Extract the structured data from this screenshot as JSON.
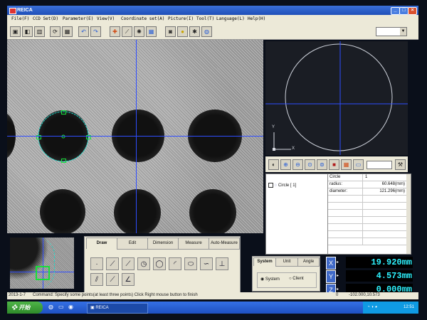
{
  "window": {
    "title": "REICA"
  },
  "menu": [
    "File(F)",
    "CCD Set(D)",
    "Parameter(E)",
    "View(V)",
    "Coordinate set(A)",
    "Picture(I)",
    "Tool(T)",
    "Language(L)",
    "Help(H)"
  ],
  "toolbar_icons": [
    "save-icon",
    "export-icon",
    "chart-icon",
    "refresh-icon",
    "calculator-icon",
    "undo-icon",
    "redo-icon",
    "crosshair-icon",
    "probe-icon",
    "light-icon",
    "grid-icon",
    "camera-icon",
    "bulb-icon",
    "settings-icon",
    "globe-icon"
  ],
  "preview": {
    "axis_y": "Y",
    "axis_x": "X"
  },
  "properties": {
    "list": [
      {
        "label": "Circle [ 1]"
      }
    ],
    "header": {
      "key": "Circle",
      "value": "1"
    },
    "rows": [
      {
        "key": "radius:",
        "value": "60.648(mm)"
      },
      {
        "key": "diameter:",
        "value": "121.296(mm)"
      }
    ]
  },
  "tool_tabs": [
    "Draw",
    "Edit",
    "Dimension",
    "Measure",
    "Auto-Measure"
  ],
  "active_tab": "Draw",
  "draw_tools": [
    "point-tool-icon",
    "line-tool-icon",
    "line2-tool-icon",
    "circle-3pt-icon",
    "circle-icon",
    "arc-icon",
    "ellipse-icon",
    "curve-icon",
    "perpendicular-icon",
    "hatch-icon",
    "angle-line-icon",
    "angle-tool-icon"
  ],
  "system_tabs": [
    "System",
    "Unit",
    "Angle"
  ],
  "system_options": {
    "system": "System",
    "client": "Client"
  },
  "coords": {
    "x_label": "X",
    "y_label": "Y",
    "z_label": "Z",
    "x": "19.920mm",
    "y": "4.573mm",
    "z": "0.000mm",
    "position": "-102.000,10.573",
    "index": "0"
  },
  "status": {
    "date": "2013-1-7",
    "command": "Command:  Specify some points(at least three points)  Click Right mouse button to finish"
  },
  "taskbar": {
    "start": "开始",
    "app": "REICA",
    "time": "12:51"
  },
  "colors": {
    "crosshair": "#2f4dff",
    "handle": "#17e03a",
    "readout": "#2ef3ff"
  }
}
